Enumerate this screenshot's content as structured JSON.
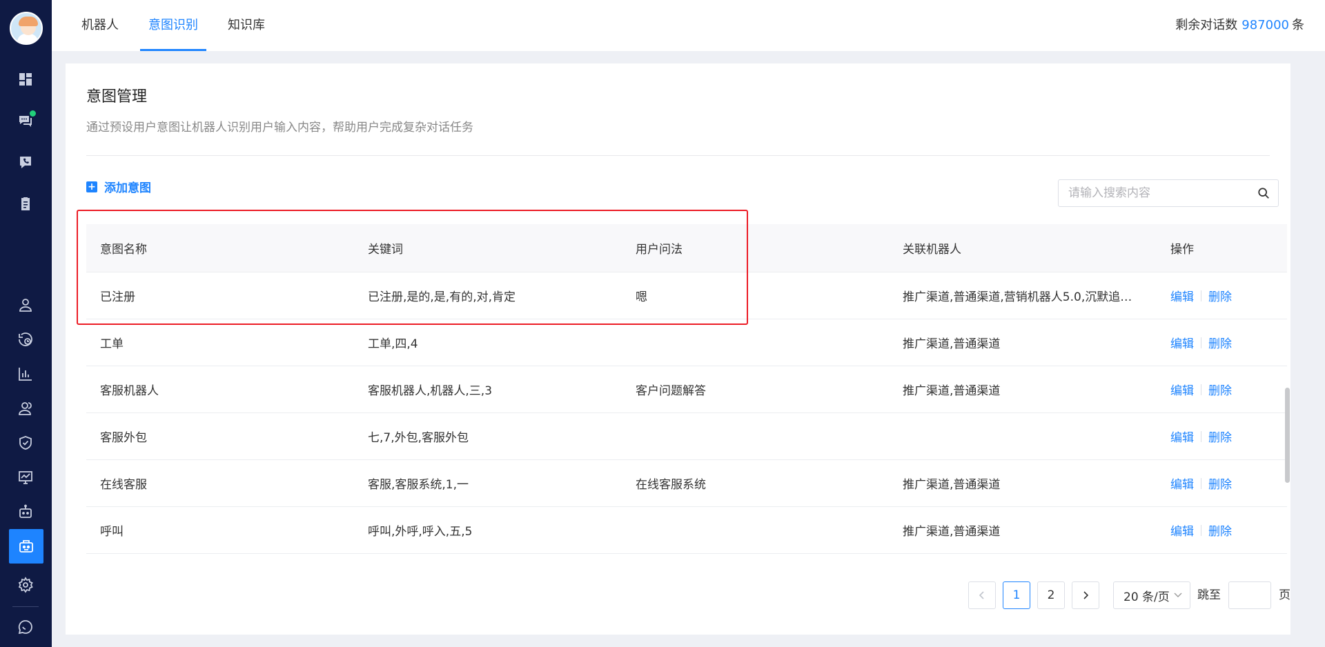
{
  "sidebar": {
    "items": [
      {
        "name": "dashboard-icon"
      },
      {
        "name": "chat-icon",
        "badge": true
      },
      {
        "name": "phone-chat-icon"
      },
      {
        "name": "clipboard-icon"
      },
      {
        "name": "user-icon"
      },
      {
        "name": "history-icon"
      },
      {
        "name": "bar-chart-icon"
      },
      {
        "name": "users-icon"
      },
      {
        "name": "shield-check-icon"
      },
      {
        "name": "monitor-chart-icon"
      },
      {
        "name": "robot-icon"
      },
      {
        "name": "intent-icon",
        "active": true
      },
      {
        "name": "gear-icon"
      },
      {
        "name": "message-circle-icon"
      }
    ]
  },
  "topbar": {
    "tabs": [
      {
        "label": "机器人",
        "active": false
      },
      {
        "label": "意图识别",
        "active": true
      },
      {
        "label": "知识库",
        "active": false
      }
    ],
    "quota_label": "剩余对话数",
    "quota_value": "987000",
    "quota_unit": "条"
  },
  "page": {
    "title": "意图管理",
    "subtitle": "通过预设用户意图让机器人识别用户输入内容，帮助用户完成复杂对话任务",
    "add_button": "添加意图",
    "search_placeholder": "请输入搜索内容"
  },
  "table": {
    "headers": [
      "意图名称",
      "关键词",
      "用户问法",
      "关联机器人",
      "操作"
    ],
    "rows": [
      {
        "name": "已注册",
        "keywords": "已注册,是的,是,有的,对,肯定",
        "question": "嗯",
        "robots": "推广渠道,普通渠道,营销机器人5.0,沉默追问..."
      },
      {
        "name": "工单",
        "keywords": "工单,四,4",
        "question": "",
        "robots": "推广渠道,普通渠道"
      },
      {
        "name": "客服机器人",
        "keywords": "客服机器人,机器人,三,3",
        "question": "客户问题解答",
        "robots": "推广渠道,普通渠道"
      },
      {
        "name": "客服外包",
        "keywords": "七,7,外包,客服外包",
        "question": "",
        "robots": ""
      },
      {
        "name": "在线客服",
        "keywords": "客服,客服系统,1,一",
        "question": "在线客服系统",
        "robots": "推广渠道,普通渠道"
      },
      {
        "name": "呼叫",
        "keywords": "呼叫,外呼,呼入,五,5",
        "question": "",
        "robots": "推广渠道,普通渠道"
      }
    ],
    "edit_label": "编辑",
    "delete_label": "删除"
  },
  "pagination": {
    "pages": [
      "1",
      "2"
    ],
    "current": "1",
    "page_size": "20 条/页",
    "jump_label": "跳至",
    "page_suffix": "页"
  },
  "colors": {
    "sidebar_bg": "#0f1a44",
    "accent": "#1e84ff",
    "highlight_box": "#ec1b24",
    "badge": "#21d07a"
  }
}
